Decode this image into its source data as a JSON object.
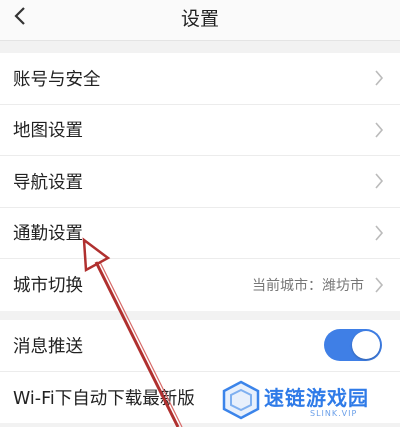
{
  "header": {
    "title": "设置",
    "back_icon": "chevron-left-icon"
  },
  "group1": {
    "items": [
      {
        "label": "账号与安全"
      },
      {
        "label": "地图设置"
      },
      {
        "label": "导航设置"
      },
      {
        "label": "通勤设置"
      },
      {
        "label": "城市切换",
        "value": "当前城市：潍坊市"
      }
    ]
  },
  "group2": {
    "items": [
      {
        "label": "消息推送",
        "toggle": true
      },
      {
        "label": "Wi-Fi下自动下载最新版"
      }
    ]
  },
  "watermark": {
    "text": "速链游戏园",
    "sub": "SLINK.VIP"
  },
  "colors": {
    "accent": "#3f7fe6",
    "annotation_arrow": "#b0302f"
  }
}
